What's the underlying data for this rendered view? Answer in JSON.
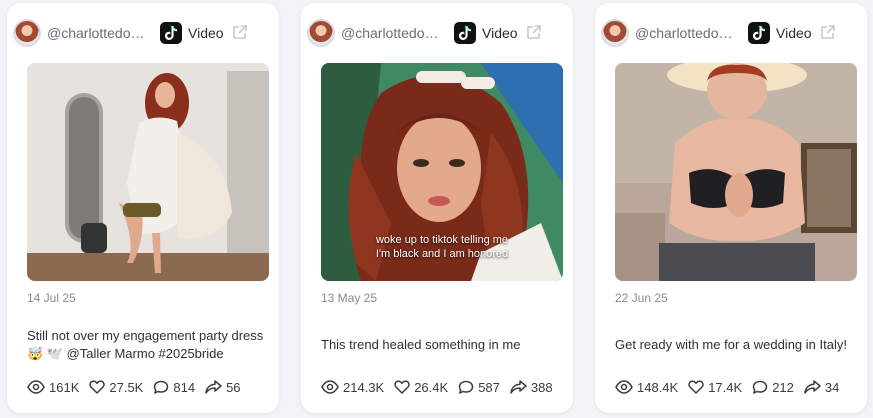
{
  "posts": [
    {
      "handle": "@charlottedob...",
      "type_label": "Video",
      "date": "14 Jul 25",
      "description_line1": "Still not over my engagement party dress",
      "description_line2": "🤯 🕊️ @Taller Marmo #2025bride",
      "overlay_line1": "",
      "overlay_line2": "",
      "stats": {
        "views": "161K",
        "likes": "27.5K",
        "comments": "814",
        "shares": "56"
      }
    },
    {
      "handle": "@charlottedob...",
      "type_label": "Video",
      "date": "13 May 25",
      "description_line1": "This trend healed something in me",
      "description_line2": "",
      "overlay_line1": "woke up to tiktok telling me",
      "overlay_line2": "I'm black and I am honored",
      "stats": {
        "views": "214.3K",
        "likes": "26.4K",
        "comments": "587",
        "shares": "388"
      }
    },
    {
      "handle": "@charlottedob...",
      "type_label": "Video",
      "date": "22 Jun 25",
      "description_line1": "Get ready with me for a wedding in Italy!",
      "description_line2": "",
      "overlay_line1": "",
      "overlay_line2": "",
      "stats": {
        "views": "148.4K",
        "likes": "17.4K",
        "comments": "212",
        "shares": "34"
      }
    }
  ],
  "icons": {
    "platform": "tiktok-icon",
    "open": "external-link-icon",
    "views": "eye-icon",
    "likes": "heart-icon",
    "comments": "comment-icon",
    "shares": "share-icon"
  },
  "colors": {
    "card_bg": "#ffffff",
    "page_bg": "#f3f3f7",
    "muted_text": "#8a8a98",
    "tiktok_bg": "#111111"
  }
}
